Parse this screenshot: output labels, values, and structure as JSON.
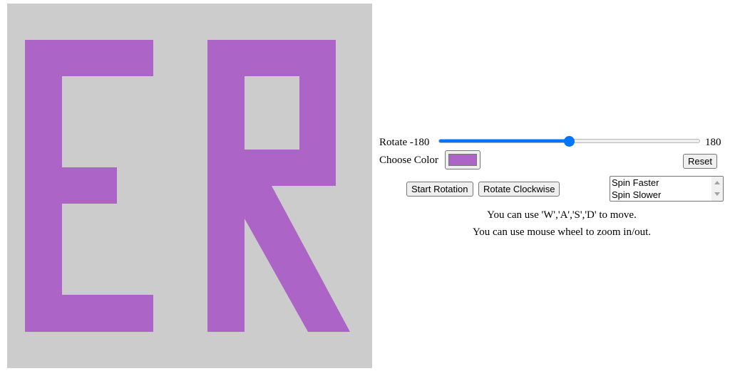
{
  "canvas": {
    "letters": "ER",
    "background_color": "#cccccc",
    "shape_color": "#ad64c7"
  },
  "controls": {
    "rotate": {
      "label": "Rotate -180",
      "max_label": "180",
      "min": -180,
      "max": 180,
      "value": 0
    },
    "color": {
      "label": "Choose Color",
      "value": "#ad64c7"
    },
    "reset_label": "Reset",
    "start_rotation_label": "Start Rotation",
    "rotate_clockwise_label": "Rotate Clockwise",
    "spin_options": [
      "Spin Faster",
      "Spin Slower"
    ]
  },
  "hints": {
    "move": "You can use 'W','A','S','D' to move.",
    "zoom": "You can use mouse wheel to zoom in/out."
  }
}
